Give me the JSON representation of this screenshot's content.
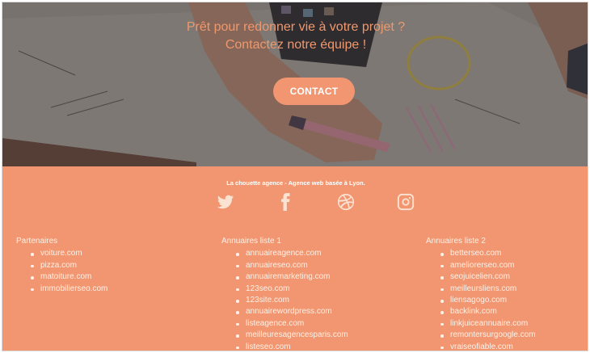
{
  "hero": {
    "line1": "Prêt pour redonner vie à votre projet ?",
    "line2": "Contactez notre équipe !",
    "button_label": "CONTACT"
  },
  "footer": {
    "tagline": "La chouette agence - Agence web basée à Lyon.",
    "socials": [
      {
        "icon": "twitter-icon"
      },
      {
        "icon": "facebook-icon"
      },
      {
        "icon": "dribbble-icon"
      },
      {
        "icon": "instagram-icon"
      }
    ],
    "columns": [
      {
        "title": "Partenaires",
        "items": [
          "voiture.com",
          "pizza.com",
          "matoiture.com",
          "immobilierseo.com"
        ]
      },
      {
        "title": "Annuaires liste 1",
        "items": [
          "annuaireagence.com",
          "annuaireseo.com",
          "annuairemarketing.com",
          "123seo.com",
          "123site.com",
          "annuairewordpress.com",
          "listeagence.com",
          "meilleuresagencesparis.com",
          "listeseo.com"
        ]
      },
      {
        "title": "Annuaires liste 2",
        "items": [
          "betterseo.com",
          "ameliorerseo.com",
          "seojuicelien.com",
          "meilleursliens.com",
          "liensagogo.com",
          "backlink.com",
          "linkjuiceannuaire.com",
          "remontersurgoogle.com",
          "vraiseofiable.com"
        ]
      }
    ]
  },
  "colors": {
    "accent": "#f19670",
    "hero_text": "#f0986d"
  }
}
